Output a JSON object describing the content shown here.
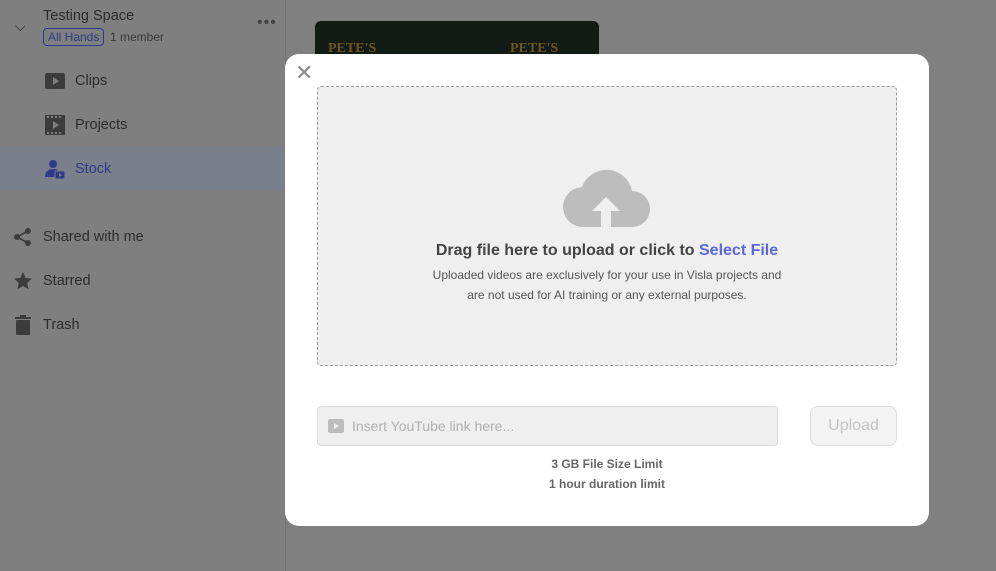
{
  "sidebar": {
    "space": {
      "title": "Testing Space",
      "badge": "All Hands",
      "members": "1 member"
    },
    "space_items": [
      {
        "label": "Clips",
        "icon": "play-icon"
      },
      {
        "label": "Projects",
        "icon": "film-icon"
      },
      {
        "label": "Stock",
        "icon": "user-video-icon",
        "selected": true
      }
    ],
    "nav_items": [
      {
        "label": "Shared with me",
        "icon": "share-icon"
      },
      {
        "label": "Starred",
        "icon": "star-icon"
      },
      {
        "label": "Trash",
        "icon": "trash-icon"
      }
    ]
  },
  "background": {
    "thumbnail_text": [
      "PETE'S",
      "PETE'S"
    ]
  },
  "modal": {
    "drag_text": "Drag file here to upload or click to ",
    "select_file": "Select File",
    "note_line1": "Uploaded videos are exclusively for your use in Visla projects and",
    "note_line2": "are not used for AI training or any external purposes.",
    "youtube_placeholder": "Insert YouTube link here...",
    "upload_label": "Upload",
    "limit_size": "3 GB File Size Limit",
    "limit_duration": "1 hour duration limit",
    "accent_color": "#5b67e0"
  }
}
